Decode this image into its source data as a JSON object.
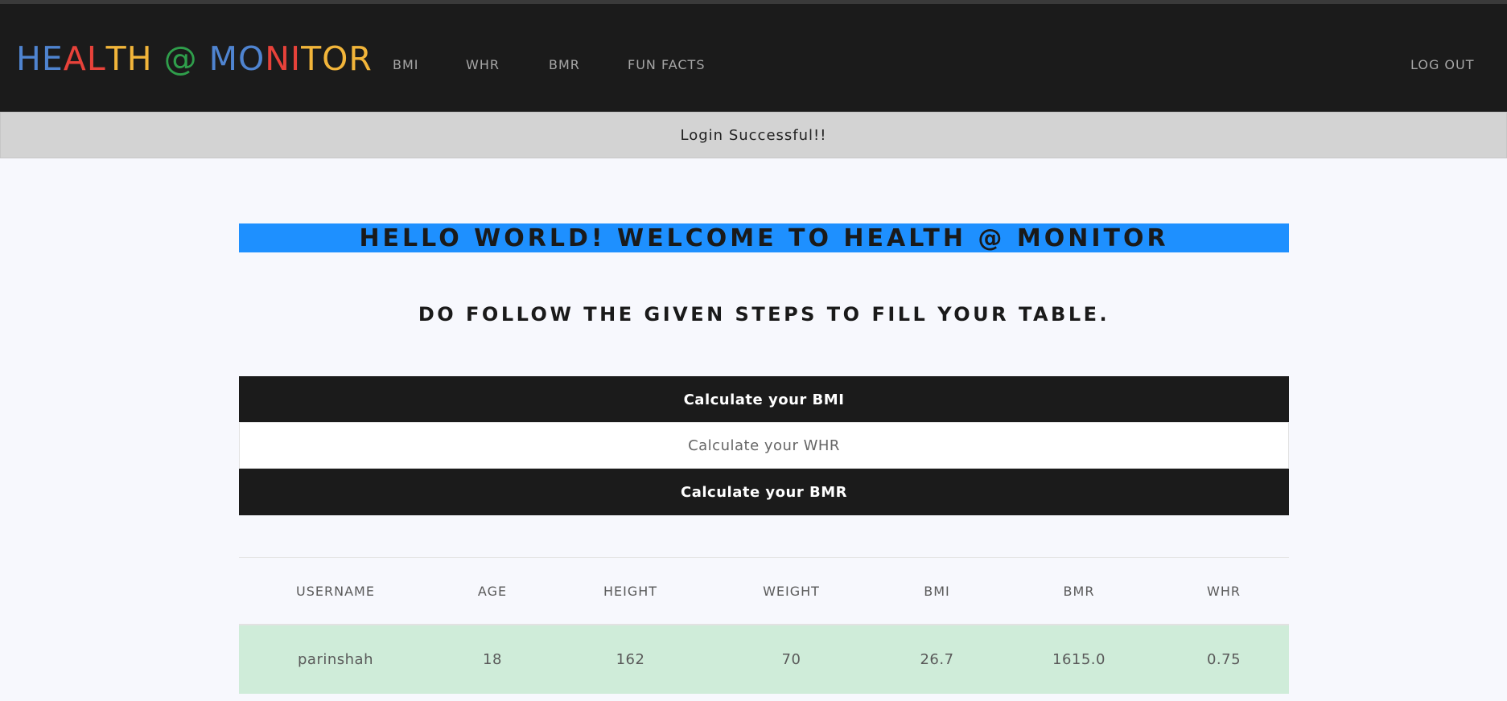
{
  "brand": {
    "letters": [
      {
        "ch": "H",
        "color": "#4f84d0"
      },
      {
        "ch": "E",
        "color": "#4f84d0"
      },
      {
        "ch": "A",
        "color": "#e8423a"
      },
      {
        "ch": "L",
        "color": "#e8423a"
      },
      {
        "ch": "T",
        "color": "#f2b53a"
      },
      {
        "ch": "H",
        "color": "#f2b53a"
      },
      {
        "ch": " ",
        "color": "#ffffff"
      },
      {
        "ch": "@",
        "color": "#2f9e4b"
      },
      {
        "ch": " ",
        "color": "#ffffff"
      },
      {
        "ch": "M",
        "color": "#4f84d0"
      },
      {
        "ch": "O",
        "color": "#4f84d0"
      },
      {
        "ch": "N",
        "color": "#e8423a"
      },
      {
        "ch": "I",
        "color": "#e8423a"
      },
      {
        "ch": "T",
        "color": "#f2b53a"
      },
      {
        "ch": "O",
        "color": "#f2b53a"
      },
      {
        "ch": "R",
        "color": "#f2b53a"
      }
    ]
  },
  "nav": {
    "bmi": "BMI",
    "whr": "WHR",
    "bmr": "BMR",
    "fun_facts": "FUN FACTS",
    "logout": "LOG OUT"
  },
  "alert": {
    "message": "Login Successful!!"
  },
  "main": {
    "welcome": "HELLO WORLD! WELCOME TO HEALTH @ MONITOR",
    "instructions": "DO FOLLOW THE GIVEN STEPS TO FILL YOUR TABLE.",
    "steps": {
      "bmi": "Calculate your BMI",
      "whr": "Calculate your WHR",
      "bmr": "Calculate your BMR"
    }
  },
  "table": {
    "headers": [
      "USERNAME",
      "AGE",
      "HEIGHT",
      "WEIGHT",
      "BMI",
      "BMR",
      "WHR"
    ],
    "rows": [
      [
        "parinshah",
        "18",
        "162",
        "70",
        "26.7",
        "1615.0",
        "0.75"
      ]
    ]
  },
  "colors": {
    "navbar_bg": "#1b1b1b",
    "hero_bg": "#1e90ff",
    "row_success_bg": "#cfecd9",
    "alert_bg": "#d3d3d3"
  }
}
